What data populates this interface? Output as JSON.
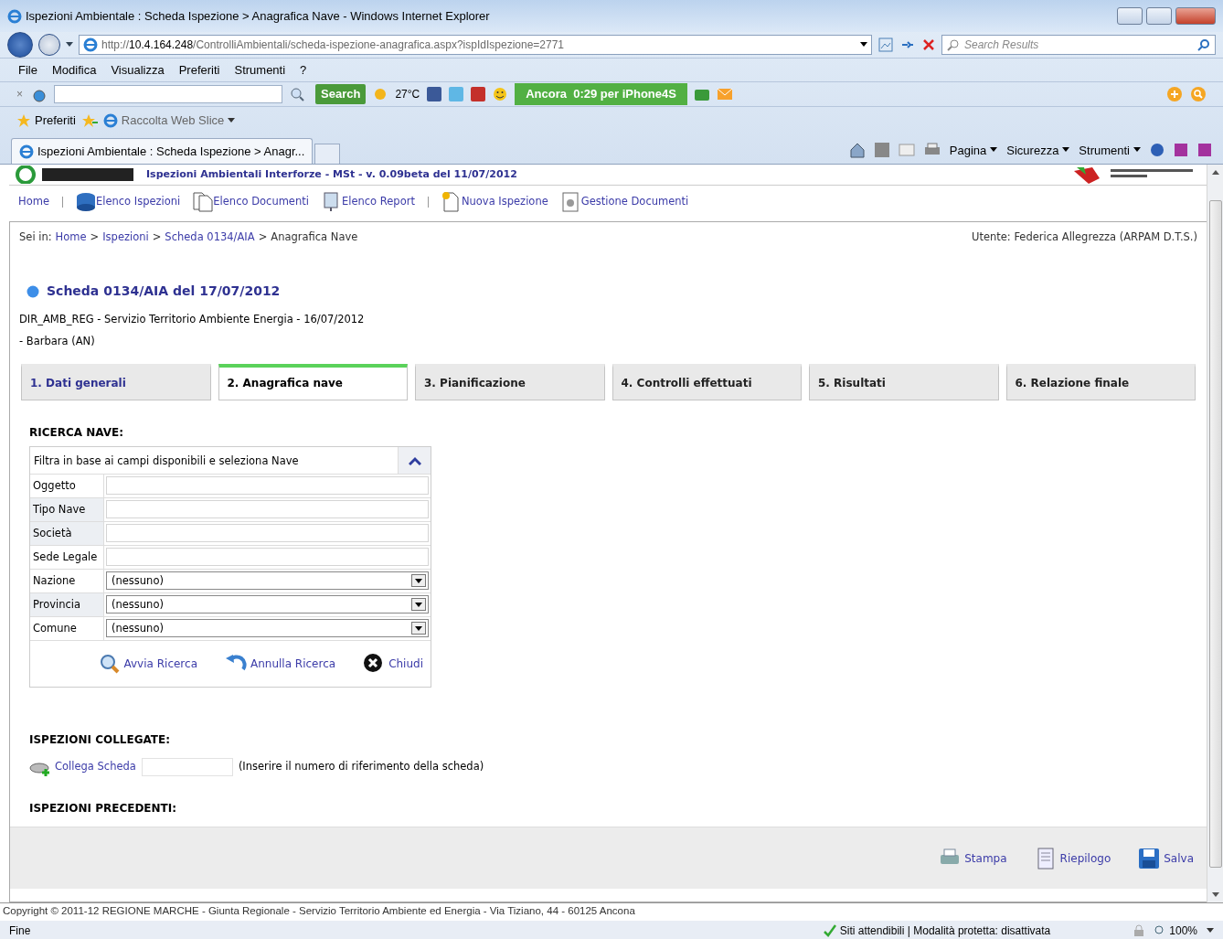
{
  "window": {
    "title": "Ispezioni Ambientale : Scheda Ispezione > Anagrafica Nave - Windows Internet Explorer"
  },
  "address": {
    "host": "10.4.164.248",
    "url_prefix": "http://",
    "url_path": "/ControlliAmbientali/scheda-ispezione-anagrafica.aspx?ispIdIspezione=2771"
  },
  "search": {
    "placeholder": "Search Results"
  },
  "menu": [
    "File",
    "Modifica",
    "Visualizza",
    "Preferiti",
    "Strumenti",
    "?"
  ],
  "toolbar": {
    "close": "×",
    "search_button": "Search",
    "weather": "27°C",
    "promo": "Ancora  0:29 per iPhone4S"
  },
  "favorites": {
    "label": "Preferiti",
    "web_slice": "Raccolta Web Slice"
  },
  "tab": {
    "title": "Ispezioni Ambientale : Scheda Ispezione > Anagr..."
  },
  "command_bar": [
    "Pagina",
    "Sicurezza",
    "Strumenti"
  ],
  "page": {
    "header_title": "Ispezioni Ambientali Interforze - MSt - v. 0.09beta del 11/07/2012",
    "nav": [
      "Home",
      "Elenco Ispezioni",
      "Elenco Documenti",
      "Elenco Report",
      "Nuova Ispezione",
      "Gestione Documenti"
    ],
    "breadcrumb": {
      "prefix": "Sei in:",
      "separator": ">",
      "links": [
        "Home",
        "Ispezioni",
        "Scheda 0134/AIA"
      ],
      "current": "Anagrafica Nave"
    },
    "user": "Utente: Federica Allegrezza (ARPAM D.T.S.)",
    "scheda": {
      "title": "Scheda 0134/AIA del 17/07/2012",
      "line_1": "DIR_AMB_REG - Servizio Territorio Ambiente Energia - 16/07/2012",
      "line_2": "- Barbara (AN)"
    },
    "steps": [
      {
        "label": "1. Dati generali",
        "selected": false,
        "visited": true
      },
      {
        "label": "2. Anagrafica nave",
        "selected": true,
        "visited": false
      },
      {
        "label": "3. Pianificazione",
        "selected": false,
        "visited": false
      },
      {
        "label": "4. Controlli effettuati",
        "selected": false,
        "visited": false
      },
      {
        "label": "5. Risultati",
        "selected": false,
        "visited": false
      },
      {
        "label": "6. Relazione finale",
        "selected": false,
        "visited": false
      }
    ],
    "search_section": {
      "heading": "RICERCA NAVE:",
      "caption": "Filtra in base ai campi disponibili e seleziona Nave",
      "expanded": true,
      "fields": [
        {
          "label": "Oggetto",
          "kind": "text"
        },
        {
          "label": "Tipo Nave",
          "kind": "text"
        },
        {
          "label": "Società",
          "kind": "text"
        },
        {
          "label": "Sede Legale",
          "kind": "text"
        },
        {
          "label": "Nazione",
          "kind": "select",
          "value": "(nessuno)"
        },
        {
          "label": "Provincia",
          "kind": "select",
          "value": "(nessuno)"
        },
        {
          "label": "Comune",
          "kind": "select",
          "value": "(nessuno)"
        }
      ],
      "actions": [
        "Avvia Ricerca",
        "Annulla Ricerca",
        "Chiudi"
      ]
    },
    "linked": {
      "heading": "ISPEZIONI COLLEGATE:",
      "link": "Collega Scheda",
      "hint": "(Inserire il numero di riferimento della scheda)"
    },
    "previous": {
      "heading": "ISPEZIONI PRECEDENTI:"
    },
    "footer_buttons": [
      "Stampa",
      "Riepilogo",
      "Salva"
    ],
    "copyright": "Copyright © 2011-12 REGIONE MARCHE - Giunta Regionale - Servizio Territorio Ambiente ed Energia - Via Tiziano, 44 - 60125 Ancona"
  },
  "status_bar": {
    "left": "Fine",
    "zone": "Siti attendibili | Modalità protetta: disattivata",
    "zoom": "100%"
  }
}
